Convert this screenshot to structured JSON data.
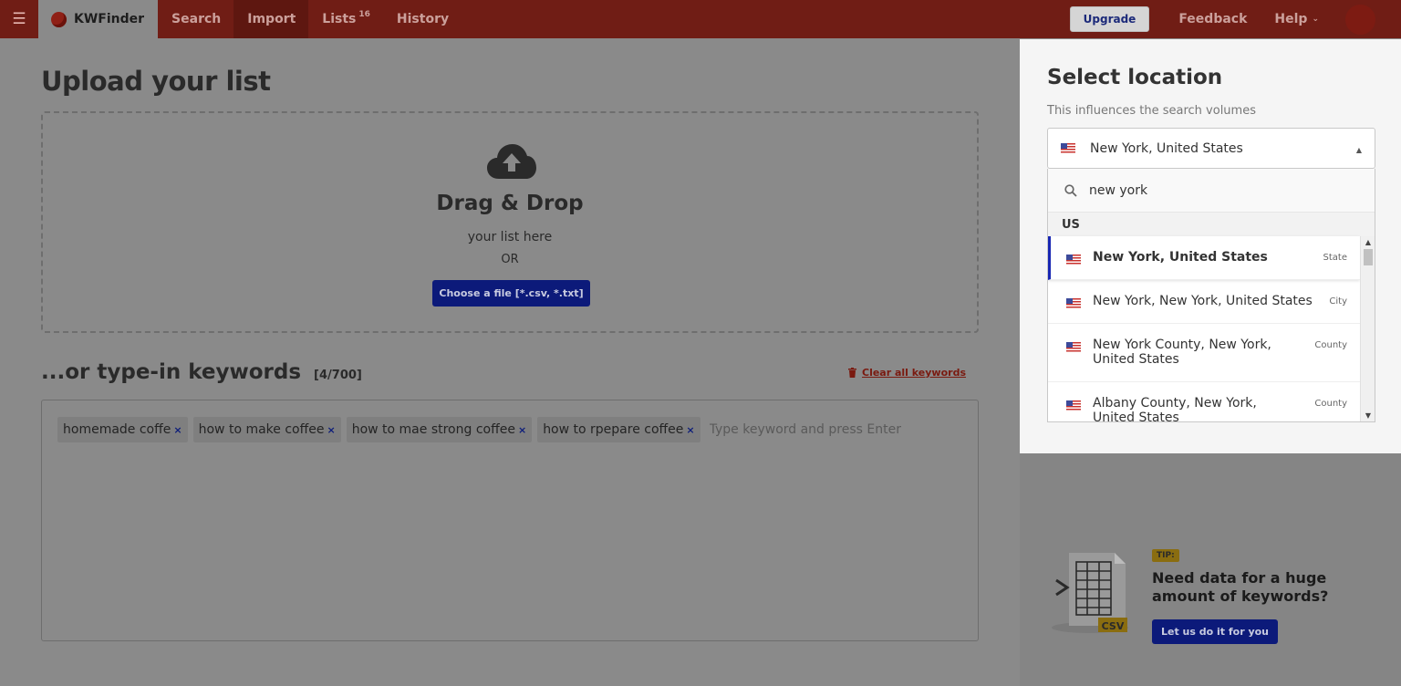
{
  "nav": {
    "brand": "KWFinder",
    "items": [
      {
        "label": "Search"
      },
      {
        "label": "Import"
      },
      {
        "label": "Lists",
        "badge": "16"
      },
      {
        "label": "History"
      }
    ],
    "upgrade": "Upgrade",
    "feedback": "Feedback",
    "help": "Help"
  },
  "upload": {
    "title": "Upload your list",
    "drag_title": "Drag & Drop",
    "drag_sub": "your list here",
    "or": "OR",
    "choose_button": "Choose a file [*.csv, *.txt]"
  },
  "keywords": {
    "title": "...or type-in keywords",
    "count": "[4/700]",
    "clear_all": "Clear all keywords",
    "tags": [
      "homemade coffe",
      "how to make coffee",
      "how to mae strong coffee",
      "how to rpepare coffee"
    ],
    "tag_remove": "×",
    "placeholder": "Type keyword and press Enter"
  },
  "location": {
    "title": "Select location",
    "subtitle": "This influences the search volumes",
    "selected": "New York, United States",
    "search_value": "new york",
    "group": "US",
    "options": [
      {
        "name": "New York, United States",
        "type": "State"
      },
      {
        "name": "New York, New York, United States",
        "type": "City"
      },
      {
        "name": "New York County, New York, United States",
        "type": "County"
      },
      {
        "name": "Albany County, New York, United States",
        "type": "County"
      }
    ]
  },
  "tip": {
    "badge": "TIP:",
    "text": "Need data for a huge amount of keywords?",
    "button": "Let us do it for you",
    "file_label": "CSV"
  },
  "colors": {
    "topbar": "#701d15",
    "primary_button": "#0c1a7a",
    "selected_accent": "#1826b3"
  }
}
